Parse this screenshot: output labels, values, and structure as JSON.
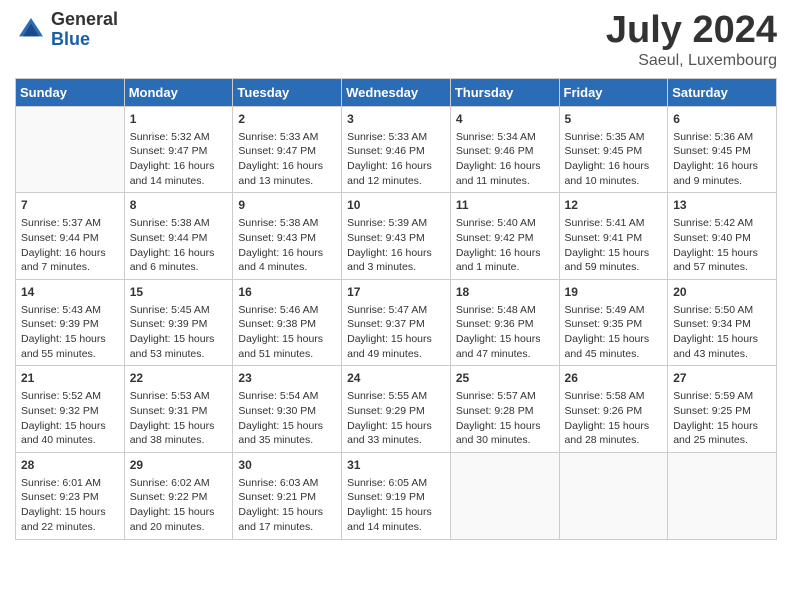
{
  "header": {
    "logo_general": "General",
    "logo_blue": "Blue",
    "month_title": "July 2024",
    "subtitle": "Saeul, Luxembourg"
  },
  "calendar": {
    "weekdays": [
      "Sunday",
      "Monday",
      "Tuesday",
      "Wednesday",
      "Thursday",
      "Friday",
      "Saturday"
    ],
    "weeks": [
      [
        {
          "day": "",
          "info": ""
        },
        {
          "day": "1",
          "info": "Sunrise: 5:32 AM\nSunset: 9:47 PM\nDaylight: 16 hours\nand 14 minutes."
        },
        {
          "day": "2",
          "info": "Sunrise: 5:33 AM\nSunset: 9:47 PM\nDaylight: 16 hours\nand 13 minutes."
        },
        {
          "day": "3",
          "info": "Sunrise: 5:33 AM\nSunset: 9:46 PM\nDaylight: 16 hours\nand 12 minutes."
        },
        {
          "day": "4",
          "info": "Sunrise: 5:34 AM\nSunset: 9:46 PM\nDaylight: 16 hours\nand 11 minutes."
        },
        {
          "day": "5",
          "info": "Sunrise: 5:35 AM\nSunset: 9:45 PM\nDaylight: 16 hours\nand 10 minutes."
        },
        {
          "day": "6",
          "info": "Sunrise: 5:36 AM\nSunset: 9:45 PM\nDaylight: 16 hours\nand 9 minutes."
        }
      ],
      [
        {
          "day": "7",
          "info": "Sunrise: 5:37 AM\nSunset: 9:44 PM\nDaylight: 16 hours\nand 7 minutes."
        },
        {
          "day": "8",
          "info": "Sunrise: 5:38 AM\nSunset: 9:44 PM\nDaylight: 16 hours\nand 6 minutes."
        },
        {
          "day": "9",
          "info": "Sunrise: 5:38 AM\nSunset: 9:43 PM\nDaylight: 16 hours\nand 4 minutes."
        },
        {
          "day": "10",
          "info": "Sunrise: 5:39 AM\nSunset: 9:43 PM\nDaylight: 16 hours\nand 3 minutes."
        },
        {
          "day": "11",
          "info": "Sunrise: 5:40 AM\nSunset: 9:42 PM\nDaylight: 16 hours\nand 1 minute."
        },
        {
          "day": "12",
          "info": "Sunrise: 5:41 AM\nSunset: 9:41 PM\nDaylight: 15 hours\nand 59 minutes."
        },
        {
          "day": "13",
          "info": "Sunrise: 5:42 AM\nSunset: 9:40 PM\nDaylight: 15 hours\nand 57 minutes."
        }
      ],
      [
        {
          "day": "14",
          "info": "Sunrise: 5:43 AM\nSunset: 9:39 PM\nDaylight: 15 hours\nand 55 minutes."
        },
        {
          "day": "15",
          "info": "Sunrise: 5:45 AM\nSunset: 9:39 PM\nDaylight: 15 hours\nand 53 minutes."
        },
        {
          "day": "16",
          "info": "Sunrise: 5:46 AM\nSunset: 9:38 PM\nDaylight: 15 hours\nand 51 minutes."
        },
        {
          "day": "17",
          "info": "Sunrise: 5:47 AM\nSunset: 9:37 PM\nDaylight: 15 hours\nand 49 minutes."
        },
        {
          "day": "18",
          "info": "Sunrise: 5:48 AM\nSunset: 9:36 PM\nDaylight: 15 hours\nand 47 minutes."
        },
        {
          "day": "19",
          "info": "Sunrise: 5:49 AM\nSunset: 9:35 PM\nDaylight: 15 hours\nand 45 minutes."
        },
        {
          "day": "20",
          "info": "Sunrise: 5:50 AM\nSunset: 9:34 PM\nDaylight: 15 hours\nand 43 minutes."
        }
      ],
      [
        {
          "day": "21",
          "info": "Sunrise: 5:52 AM\nSunset: 9:32 PM\nDaylight: 15 hours\nand 40 minutes."
        },
        {
          "day": "22",
          "info": "Sunrise: 5:53 AM\nSunset: 9:31 PM\nDaylight: 15 hours\nand 38 minutes."
        },
        {
          "day": "23",
          "info": "Sunrise: 5:54 AM\nSunset: 9:30 PM\nDaylight: 15 hours\nand 35 minutes."
        },
        {
          "day": "24",
          "info": "Sunrise: 5:55 AM\nSunset: 9:29 PM\nDaylight: 15 hours\nand 33 minutes."
        },
        {
          "day": "25",
          "info": "Sunrise: 5:57 AM\nSunset: 9:28 PM\nDaylight: 15 hours\nand 30 minutes."
        },
        {
          "day": "26",
          "info": "Sunrise: 5:58 AM\nSunset: 9:26 PM\nDaylight: 15 hours\nand 28 minutes."
        },
        {
          "day": "27",
          "info": "Sunrise: 5:59 AM\nSunset: 9:25 PM\nDaylight: 15 hours\nand 25 minutes."
        }
      ],
      [
        {
          "day": "28",
          "info": "Sunrise: 6:01 AM\nSunset: 9:23 PM\nDaylight: 15 hours\nand 22 minutes."
        },
        {
          "day": "29",
          "info": "Sunrise: 6:02 AM\nSunset: 9:22 PM\nDaylight: 15 hours\nand 20 minutes."
        },
        {
          "day": "30",
          "info": "Sunrise: 6:03 AM\nSunset: 9:21 PM\nDaylight: 15 hours\nand 17 minutes."
        },
        {
          "day": "31",
          "info": "Sunrise: 6:05 AM\nSunset: 9:19 PM\nDaylight: 15 hours\nand 14 minutes."
        },
        {
          "day": "",
          "info": ""
        },
        {
          "day": "",
          "info": ""
        },
        {
          "day": "",
          "info": ""
        }
      ]
    ]
  }
}
